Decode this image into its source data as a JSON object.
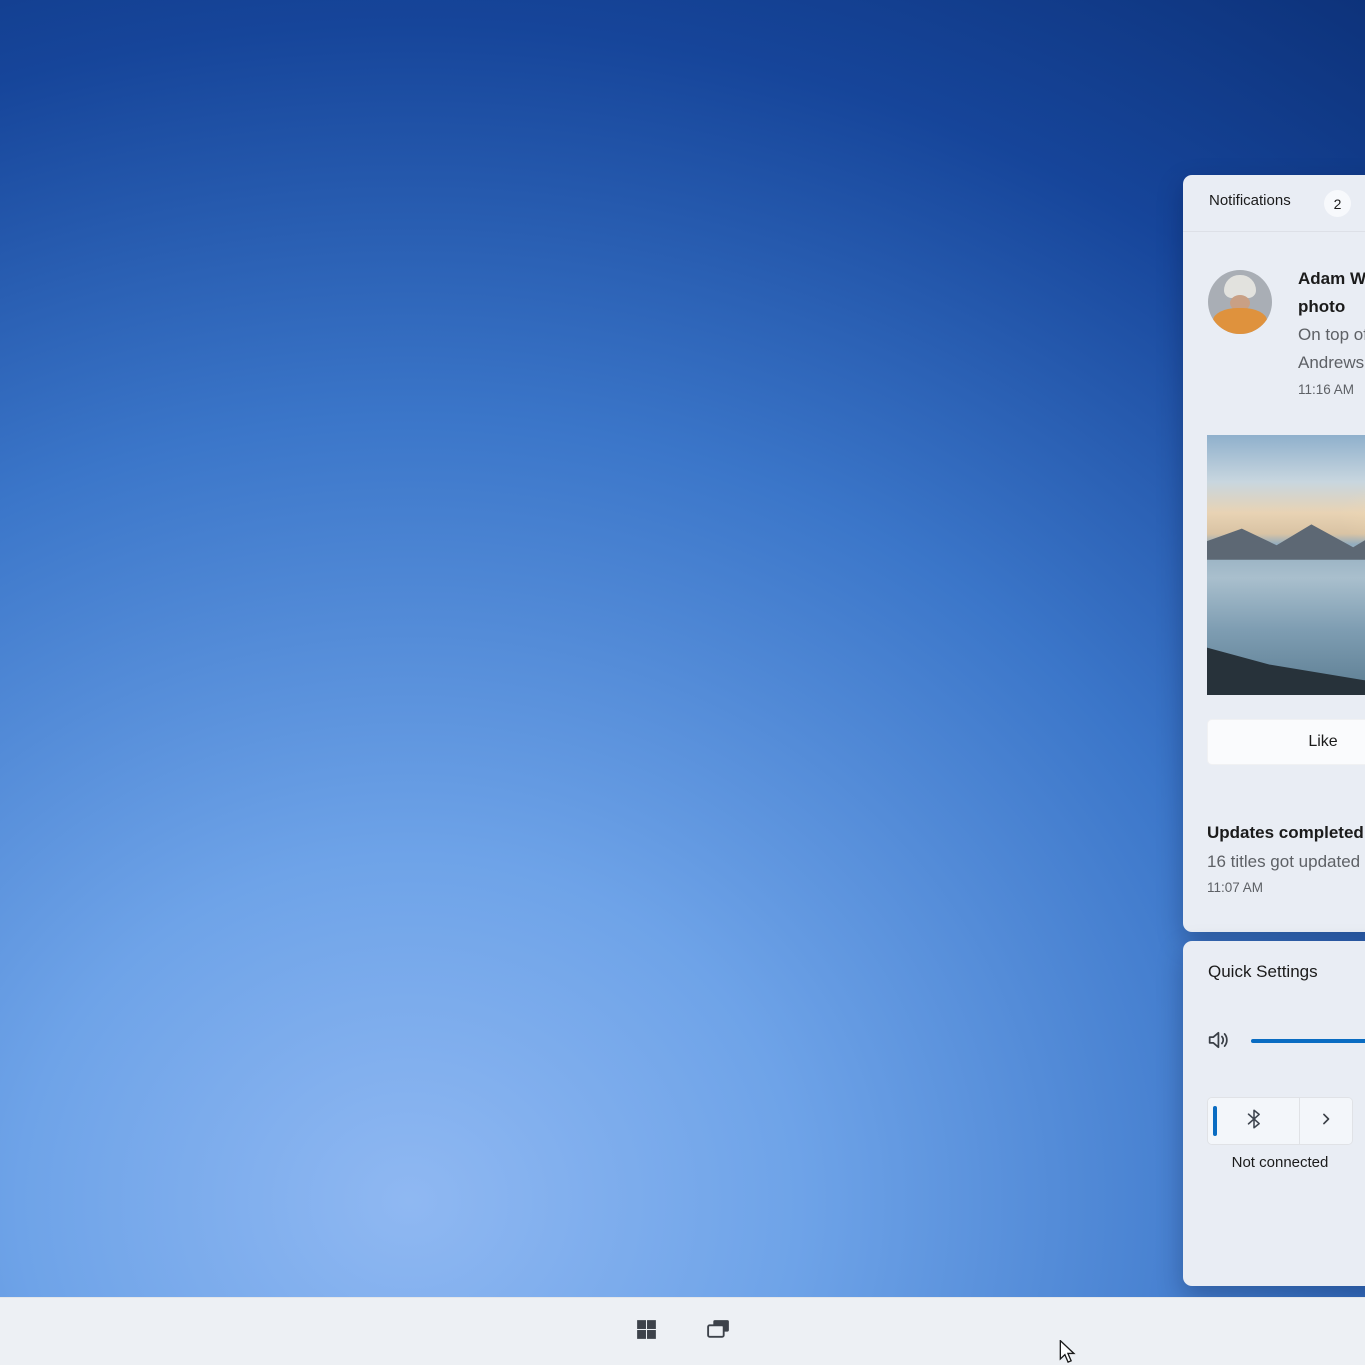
{
  "colors": {
    "accent": "#0a6cc2",
    "panel_bg": "#e9edf4",
    "taskbar_bg": "#edf0f4",
    "desktop_dark": "#0a2c70",
    "desktop_light": "#8fb8f2"
  },
  "notifications_panel": {
    "header": {
      "title": "Notifications",
      "badge_count": "2"
    },
    "notification_photo": {
      "title_line1": "Adam Wilson shared a",
      "title_line2": "photo",
      "body_line1": "On top of",
      "body_line2": "Andrews",
      "time": "11:16 AM",
      "like_button_label": "Like"
    },
    "notification_updates": {
      "title": "Updates completed",
      "body": "16 titles got updated",
      "time": "11:07 AM"
    }
  },
  "quick_settings": {
    "title": "Quick Settings",
    "bluetooth_status": "Not connected"
  },
  "icons": {
    "speaker": "speaker-volume-icon",
    "bluetooth": "bluetooth-icon",
    "chevron_right": "chevron-right-icon",
    "windows_start": "windows-start-icon",
    "task_view": "task-view-icon",
    "cursor": "arrow-cursor"
  }
}
